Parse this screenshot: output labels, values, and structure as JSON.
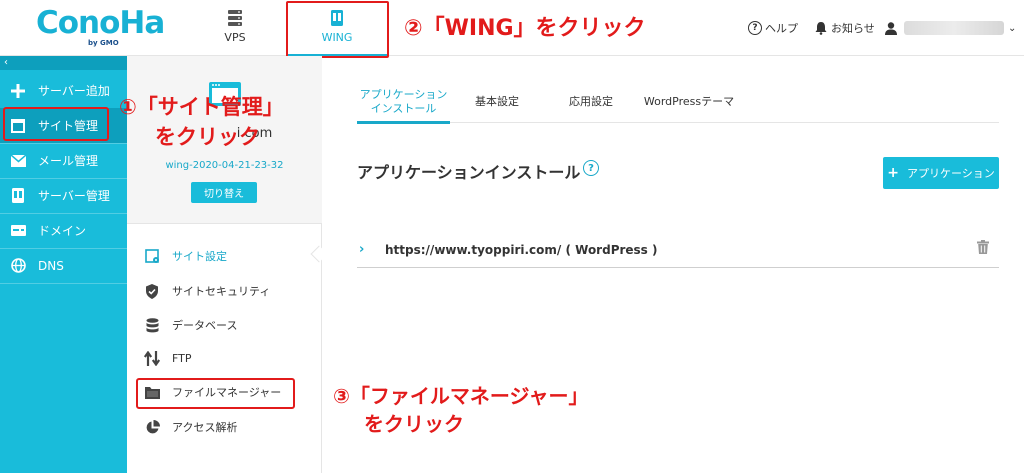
{
  "header": {
    "logo_text": "ConoHa",
    "logo_sub": "by GMO",
    "tabs": [
      {
        "label": "VPS"
      },
      {
        "label": "WING"
      }
    ],
    "help_label": "ヘルプ",
    "notice_label": "お知らせ"
  },
  "sidebar": {
    "collapse_glyph": "‹",
    "items": [
      {
        "label": "サーバー追加",
        "icon": "plus-icon"
      },
      {
        "label": "サイト管理",
        "icon": "window-icon"
      },
      {
        "label": "メール管理",
        "icon": "mail-icon"
      },
      {
        "label": "サーバー管理",
        "icon": "server-icon"
      },
      {
        "label": "ドメイン",
        "icon": "domain-icon"
      },
      {
        "label": "DNS",
        "icon": "globe-icon"
      }
    ]
  },
  "site_panel": {
    "domain_suffix": "i.com",
    "server_name": "wing-2020-04-21-23-32",
    "switch_label": "切り替え",
    "menu": [
      {
        "label": "サイト設定",
        "icon": "site-settings-icon"
      },
      {
        "label": "サイトセキュリティ",
        "icon": "shield-icon"
      },
      {
        "label": "データベース",
        "icon": "database-icon"
      },
      {
        "label": "FTP",
        "icon": "updown-arrows-icon"
      },
      {
        "label": "ファイルマネージャー",
        "icon": "folder-icon"
      },
      {
        "label": "アクセス解析",
        "icon": "pie-chart-icon"
      }
    ]
  },
  "main": {
    "tabs": [
      {
        "label_line1": "アプリケーション",
        "label_line2": "インストール"
      },
      {
        "label": "基本設定"
      },
      {
        "label": "応用設定"
      },
      {
        "label": "WordPressテーマ"
      }
    ],
    "section_title": "アプリケーションインストール",
    "help_glyph": "?",
    "add_button_label": "アプリケーション",
    "apps": [
      {
        "text": "https://www.tyoppiri.com/ ( WordPress )"
      }
    ]
  },
  "annotations": {
    "step1_line1": "①「サイト管理」",
    "step1_line2": "をクリック",
    "step2": "②「WING」をクリック",
    "step3_line1": "③「ファイルマネージャー」",
    "step3_line2": "をクリック"
  },
  "colors": {
    "brand": "#19bcda",
    "brand_dark": "#0d9fbd",
    "annotation_red": "#e21b1b"
  }
}
